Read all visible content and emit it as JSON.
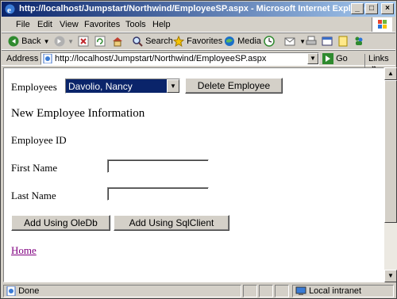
{
  "window": {
    "title": "http://localhost/Jumpstart/Northwind/EmployeeSP.aspx - Microsoft Internet Explorer",
    "controls": {
      "minimize": "_",
      "maximize": "□",
      "close": "×"
    }
  },
  "menu": {
    "items": [
      "File",
      "Edit",
      "View",
      "Favorites",
      "Tools",
      "Help"
    ]
  },
  "toolbar": {
    "back": "Back",
    "search": "Search",
    "favorites": "Favorites",
    "media": "Media"
  },
  "address": {
    "label": "Address",
    "url": "http://localhost/Jumpstart/Northwind/EmployeeSP.aspx",
    "go": "Go",
    "links": "Links",
    "chevron": "»"
  },
  "page": {
    "employees_label": "Employees",
    "employee_selected": "Davolio, Nancy",
    "delete_button": "Delete Employee",
    "section_heading": "New Employee Information",
    "employee_id_label": "Employee ID",
    "first_name_label": "First Name",
    "first_name_value": "",
    "last_name_label": "Last Name",
    "last_name_value": "",
    "add_oledb_button": "Add Using OleDb",
    "add_sqlclient_button": "Add Using SqlClient",
    "home_link": "Home"
  },
  "status": {
    "text": "Done",
    "zone": "Local intranet"
  },
  "colors": {
    "title_bar_start": "#0a246a",
    "title_bar_end": "#a6caf0",
    "selection": "#0a246a",
    "visited_link": "#800080"
  },
  "icons": [
    "ie-icon",
    "back-arrow-icon",
    "forward-arrow-icon",
    "stop-icon",
    "refresh-icon",
    "home-icon",
    "search-icon",
    "favorites-star-icon",
    "media-icon",
    "history-icon",
    "mail-icon",
    "print-icon",
    "edit-icon",
    "messenger-icon",
    "page-icon",
    "go-arrow-icon",
    "windows-flag-icon",
    "intranet-icon"
  ]
}
